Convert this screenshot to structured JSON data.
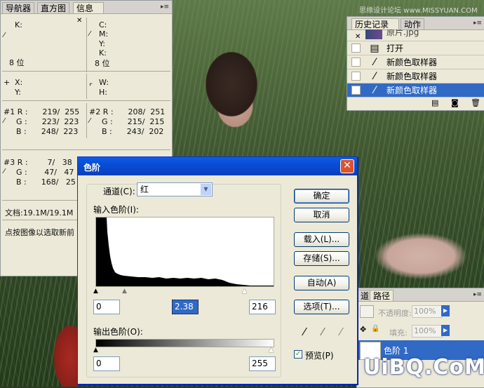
{
  "watermark": {
    "top": "思缘设计论坛 www.MISSYUAN.COM",
    "bottom": "UiBQ.CoM"
  },
  "info_palette": {
    "tabs": [
      "导航器",
      "直方图",
      "信息"
    ],
    "active_tab": "信息",
    "rows": {
      "k_left": "K:",
      "bits_left": "8 位",
      "c": "C:",
      "m": "M:",
      "y": "Y:",
      "k_right": "K:",
      "bits_right": "8 位",
      "x": "X:",
      "y_coord": "Y:",
      "w": "W:",
      "h": "H:",
      "s1_r": "#1 R :      219/  255",
      "s1_g": "G :      223/  223",
      "s1_b": "B :      248/  223",
      "s2_r": "#2 R :      208/  251",
      "s2_g": "G :      215/  215",
      "s2_b": "B :      243/  202",
      "s3_r": "#3 R :        7/   38",
      "s3_g": "G :       47/   47",
      "s3_b": "B :      168/   25",
      "doc": "文档:19.1M/19.1M",
      "hint": "点按图像以选取新前"
    }
  },
  "history_palette": {
    "tabs": [
      "历史记录",
      "动作"
    ],
    "active_tab": "历史记录",
    "snapshot": "原片.jpg",
    "items": [
      "打开",
      "新颜色取样器",
      "新颜色取样器",
      "新颜色取样器"
    ]
  },
  "layers_palette": {
    "tabs": [
      "道",
      "路径"
    ],
    "opacity_label": "不透明度:",
    "opacity_value": "100%",
    "fill_label": "填充:",
    "fill_value": "100%",
    "layer_name": "色阶 1"
  },
  "levels_dialog": {
    "title": "色阶",
    "channel_label": "通道(C):",
    "channel_value": "红",
    "input_levels_label": "输入色阶(I):",
    "input_black": "0",
    "input_gamma": "2.38",
    "input_white": "216",
    "output_levels_label": "输出色阶(O):",
    "output_black": "0",
    "output_white": "255",
    "buttons": {
      "ok": "确定",
      "cancel": "取消",
      "load": "载入(L)...",
      "save": "存储(S)...",
      "auto": "自动(A)",
      "options": "选项(T)..."
    },
    "preview_label": "预览(P)",
    "preview_checked": true
  }
}
